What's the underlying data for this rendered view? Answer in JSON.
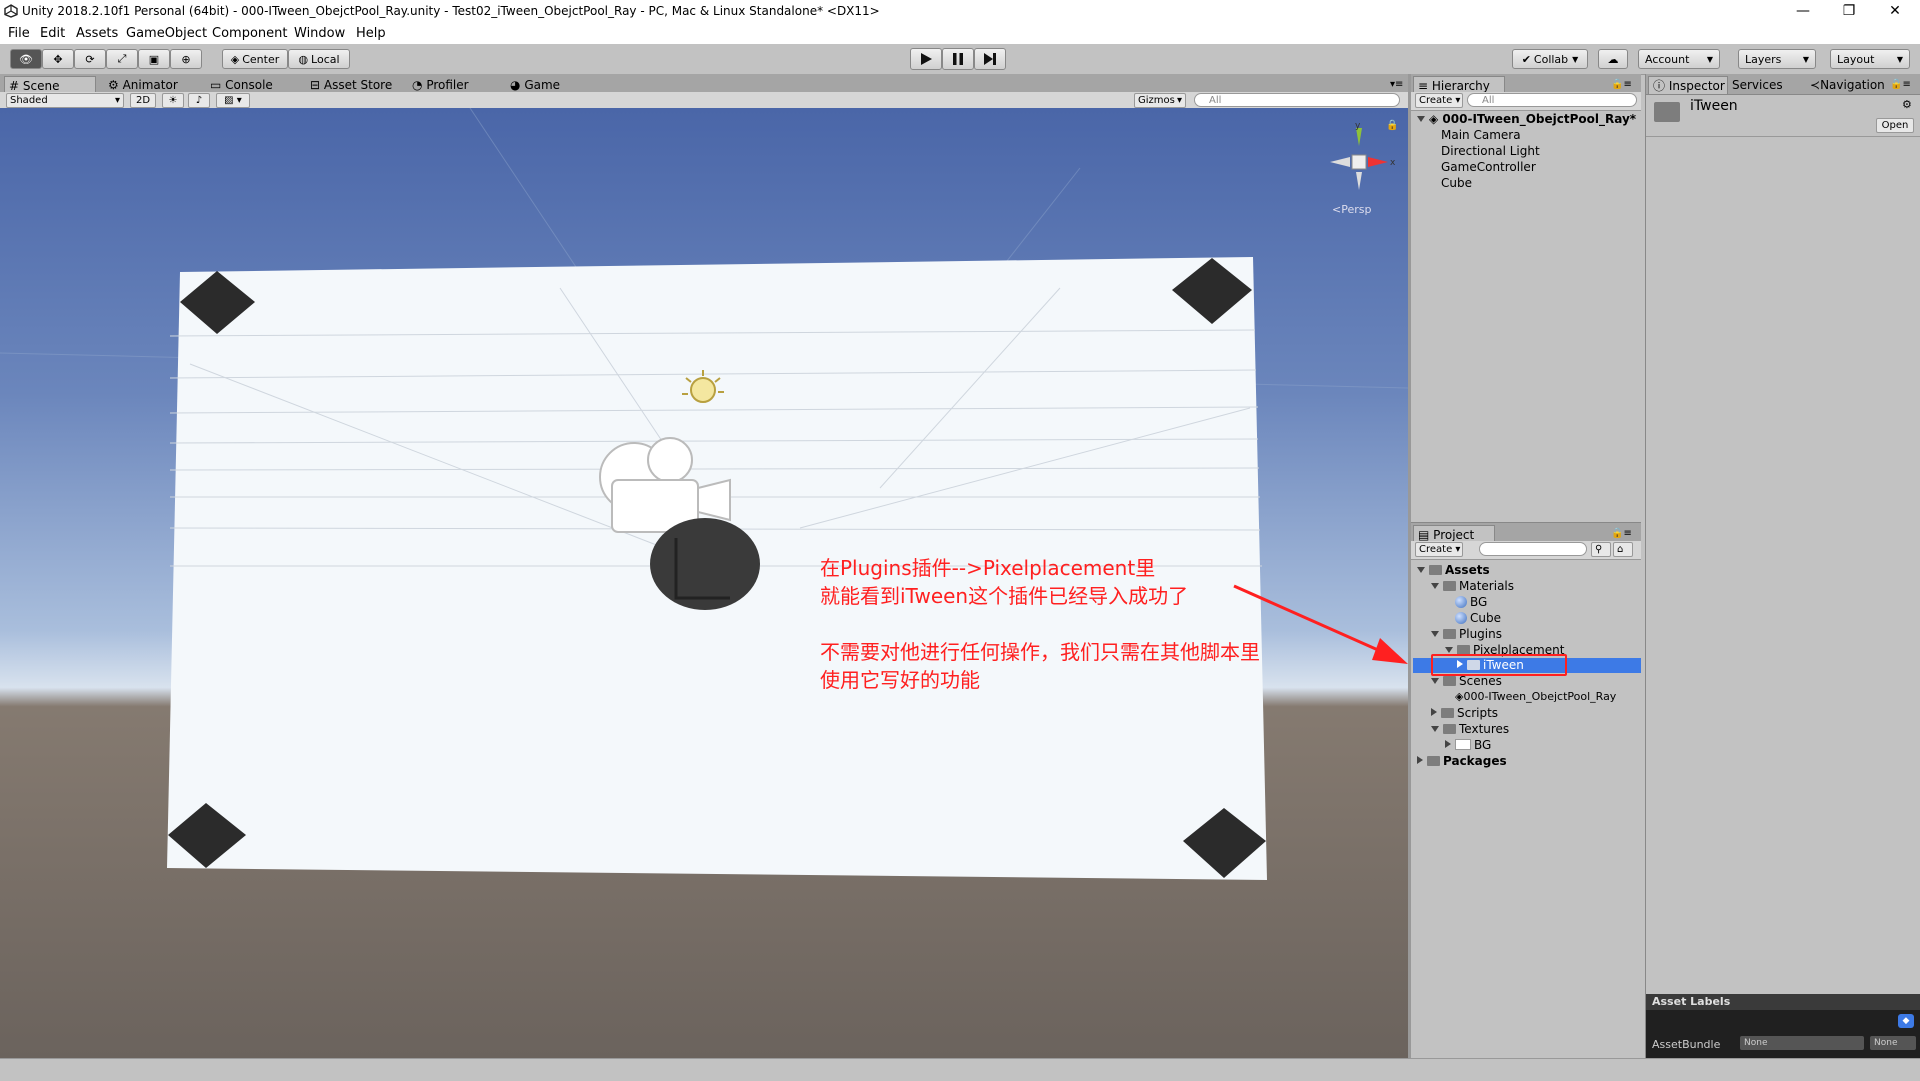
{
  "window": {
    "title": "Unity 2018.2.10f1 Personal (64bit) - 000-ITween_ObejctPool_Ray.unity - Test02_iTween_ObejctPool_Ray - PC, Mac & Linux Standalone* <DX11>",
    "minimize": "—",
    "maximize": "❐",
    "close": "✕"
  },
  "menu": [
    "File",
    "Edit",
    "Assets",
    "GameObject",
    "Component",
    "Window",
    "Help"
  ],
  "toolbar": {
    "pivot": "Center",
    "space": "Local",
    "collab": "Collab",
    "account": "Account",
    "layers": "Layers",
    "layout": "Layout"
  },
  "scene_tabs": [
    "Scene",
    "Animator",
    "Console",
    "Asset Store",
    "Profiler",
    "Game"
  ],
  "scene_bar": {
    "shading": "Shaded",
    "mode2d": "2D",
    "gizmos": "Gizmos",
    "search_placeholder": "All"
  },
  "gizmo": {
    "y": "y",
    "x": "x",
    "persp": "Persp"
  },
  "annotation": {
    "line1": "在Plugins插件-->Pixelplacement里",
    "line2": "就能看到iTween这个插件已经导入成功了",
    "line3": "不需要对他进行任何操作，我们只需在其他脚本里",
    "line4": "使用它写好的功能",
    "color": "#ff2020"
  },
  "hierarchy": {
    "tab": "Hierarchy",
    "create": "Create",
    "search_placeholder": "All",
    "scene": "000-ITween_ObejctPool_Ray*",
    "items": [
      "Main Camera",
      "Directional Light",
      "GameController",
      "Cube"
    ]
  },
  "project": {
    "tab": "Project",
    "create": "Create",
    "assets": "Assets",
    "materials": "Materials",
    "mat_bg": "BG",
    "mat_cube": "Cube",
    "plugins": "Plugins",
    "pixelplacement": "Pixelplacement",
    "itween": "iTween",
    "scenes": "Scenes",
    "scene_file": "000-ITween_ObejctPool_Ray",
    "scripts": "Scripts",
    "textures": "Textures",
    "tex_bg": "BG",
    "packages": "Packages",
    "selection_color": "#3d7ae6"
  },
  "inspector": {
    "tabs": [
      "Inspector",
      "Services",
      "Navigation"
    ],
    "object_name": "iTween",
    "open": "Open",
    "asset_labels": "Asset Labels",
    "assetbundle_label": "AssetBundle",
    "assetbundle_value": "None",
    "variant_value": "None"
  }
}
